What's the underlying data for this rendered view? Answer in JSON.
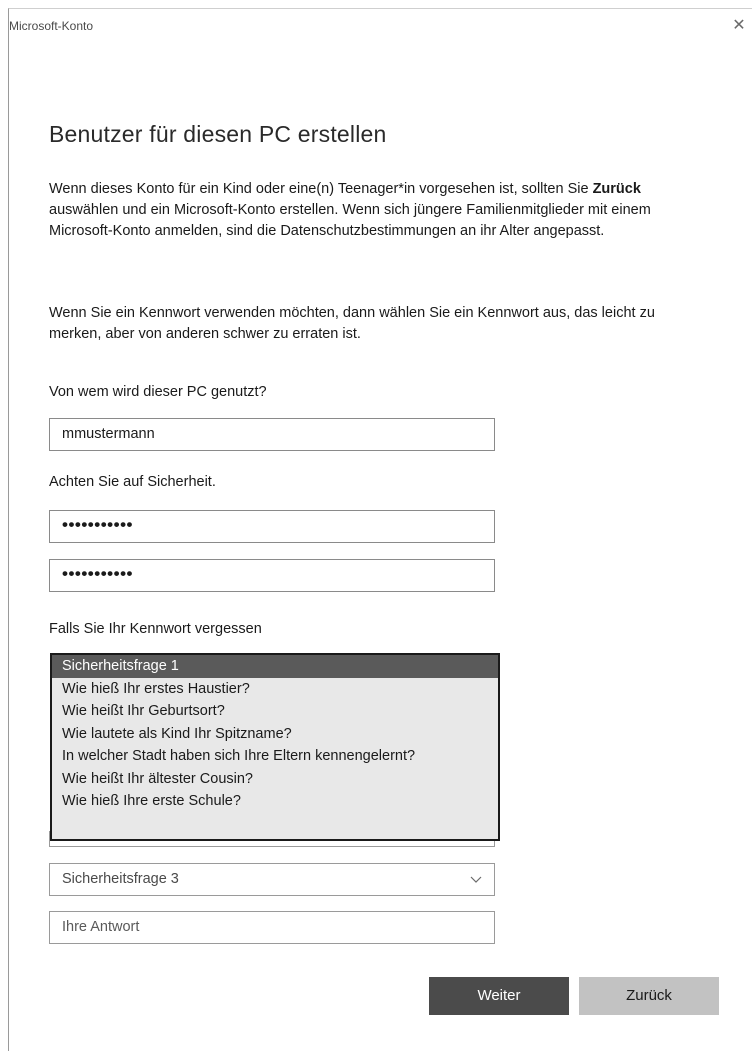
{
  "window": {
    "title": "Microsoft-Konto",
    "close_symbol": "✕"
  },
  "heading": "Benutzer für diesen PC erstellen",
  "intro": {
    "line_a": "Wenn dieses Konto für ein Kind oder eine(n) Teenager*in vorgesehen ist, sollten Sie ",
    "bold": "Zurück",
    "line_b": " auswählen und ein Microsoft-Konto erstellen. Wenn sich jüngere Familienmitglieder mit einem Microsoft-Konto anmelden, sind die Datenschutzbestimmungen an ihr Alter angepasst."
  },
  "password_hint": "Wenn Sie ein Kennwort verwenden möchten, dann wählen Sie ein Kennwort aus, das leicht zu merken, aber von anderen schwer zu erraten ist.",
  "user": {
    "label": "Von wem wird dieser PC genutzt?",
    "value": "mmustermann"
  },
  "security": {
    "label": "Achten Sie auf Sicherheit.",
    "password_value": "•••••••••••",
    "confirm_value": "•••••••••••"
  },
  "recovery": {
    "label": "Falls Sie Ihr Kennwort vergessen",
    "question1_options": [
      "Sicherheitsfrage 1",
      "Wie hieß Ihr erstes Haustier?",
      "Wie heißt Ihr Geburtsort?",
      "Wie lautete als Kind Ihr Spitzname?",
      "In welcher Stadt haben sich Ihre Eltern kennengelernt?",
      "Wie heißt Ihr ältester Cousin?",
      "Wie hieß Ihre erste Schule?"
    ],
    "question3_value": "Sicherheitsfrage 3",
    "answer_placeholder": "Ihre Antwort",
    "chevron_icon": "chevron-down-icon"
  },
  "buttons": {
    "next": "Weiter",
    "back": "Zurück"
  },
  "colors": {
    "primary_button": "#4b4b4b",
    "secondary_button": "#c2c2c2",
    "selected_option": "#5a5a5a"
  }
}
